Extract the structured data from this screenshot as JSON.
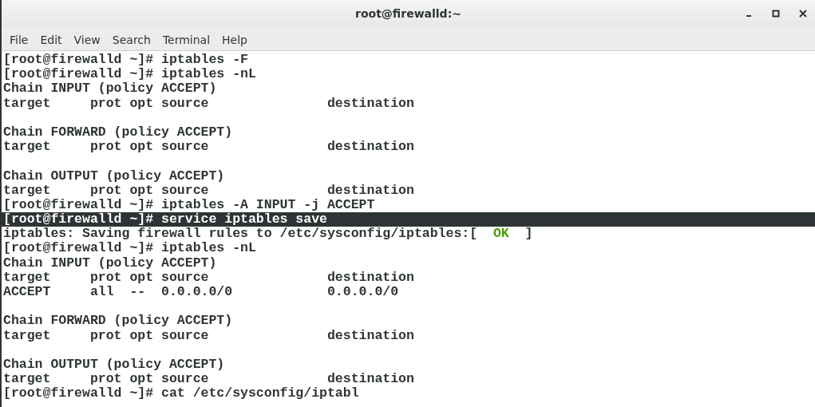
{
  "window": {
    "title": "root@firewalld:~"
  },
  "menu": [
    {
      "label": "File"
    },
    {
      "label": "Edit"
    },
    {
      "label": "View"
    },
    {
      "label": "Search"
    },
    {
      "label": "Terminal"
    },
    {
      "label": "Help"
    }
  ],
  "terminal": {
    "lines": [
      {
        "kind": "text",
        "text": "[root@firewalld ~]# iptables -F",
        "selected": false
      },
      {
        "kind": "text",
        "text": "[root@firewalld ~]# iptables -nL",
        "selected": false
      },
      {
        "kind": "text",
        "text": "Chain INPUT (policy ACCEPT)",
        "selected": false
      },
      {
        "kind": "text",
        "text": "target     prot opt source               destination",
        "selected": false
      },
      {
        "kind": "blank"
      },
      {
        "kind": "text",
        "text": "Chain FORWARD (policy ACCEPT)",
        "selected": false
      },
      {
        "kind": "text",
        "text": "target     prot opt source               destination",
        "selected": false
      },
      {
        "kind": "blank"
      },
      {
        "kind": "text",
        "text": "Chain OUTPUT (policy ACCEPT)",
        "selected": false
      },
      {
        "kind": "text",
        "text": "target     prot opt source               destination",
        "selected": false
      },
      {
        "kind": "text",
        "text": "[root@firewalld ~]# iptables -A INPUT -j ACCEPT",
        "selected": false
      },
      {
        "kind": "text",
        "text": "[root@firewalld ~]# service iptables save",
        "selected": true
      },
      {
        "kind": "status",
        "text": "iptables: Saving firewall rules to /etc/sysconfig/iptables:[  ",
        "status": "OK",
        "tail": "  ]",
        "color": "#4e9a06"
      },
      {
        "kind": "text",
        "text": "[root@firewalld ~]# iptables -nL",
        "selected": false
      },
      {
        "kind": "text",
        "text": "Chain INPUT (policy ACCEPT)",
        "selected": false
      },
      {
        "kind": "text",
        "text": "target     prot opt source               destination",
        "selected": false
      },
      {
        "kind": "text",
        "text": "ACCEPT     all  --  0.0.0.0/0            0.0.0.0/0",
        "selected": false
      },
      {
        "kind": "blank"
      },
      {
        "kind": "text",
        "text": "Chain FORWARD (policy ACCEPT)",
        "selected": false
      },
      {
        "kind": "text",
        "text": "target     prot opt source               destination",
        "selected": false
      },
      {
        "kind": "blank"
      },
      {
        "kind": "text",
        "text": "Chain OUTPUT (policy ACCEPT)",
        "selected": false
      },
      {
        "kind": "text",
        "text": "target     prot opt source               destination",
        "selected": false
      },
      {
        "kind": "text",
        "text": "[root@firewalld ~]# cat /etc/sysconfig/iptabl",
        "selected": false
      }
    ]
  }
}
